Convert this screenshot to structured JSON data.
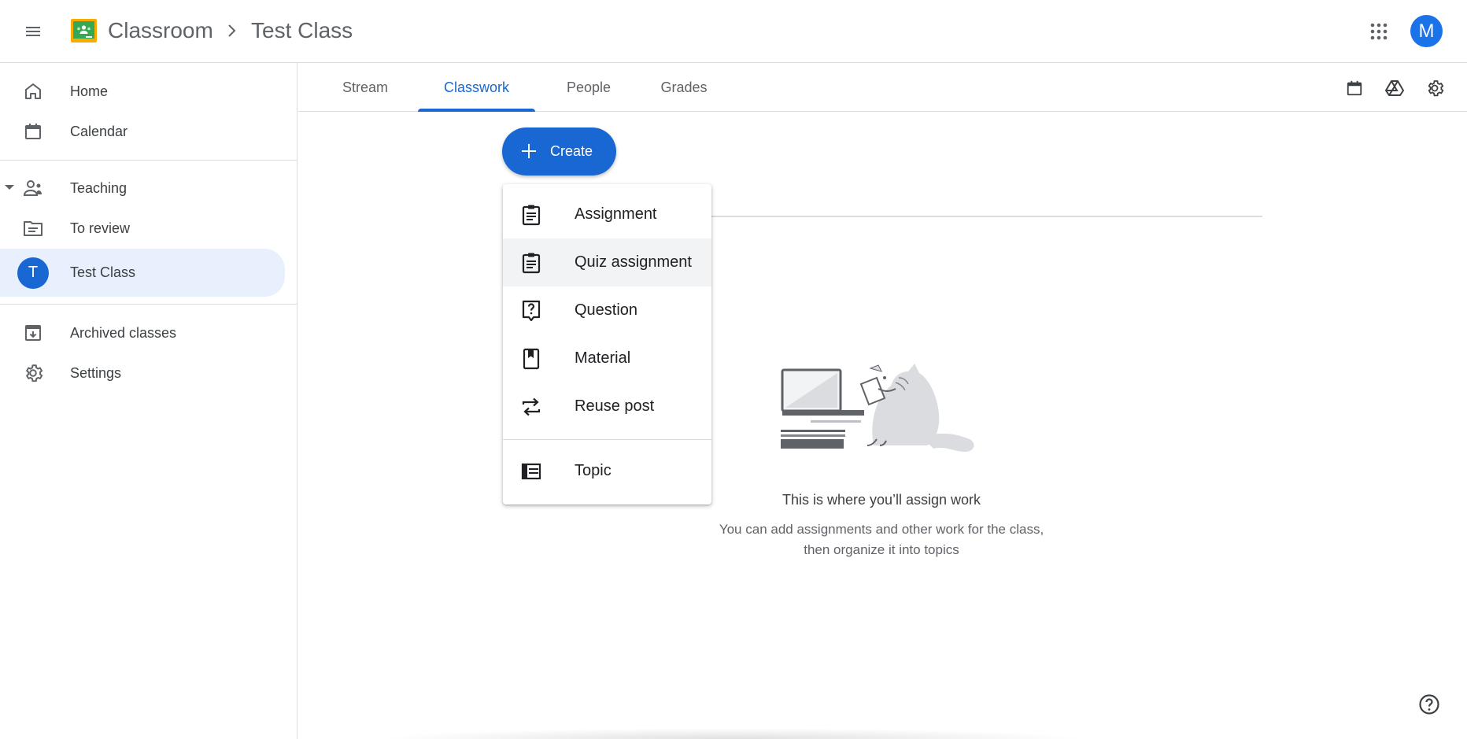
{
  "header": {
    "app_name": "Classroom",
    "breadcrumb_separator": "›",
    "class_name": "Test Class",
    "avatar_letter": "M",
    "avatar_color": "#1a73e8"
  },
  "sidebar": {
    "items": [
      {
        "label": "Home",
        "icon": "home-icon"
      },
      {
        "label": "Calendar",
        "icon": "calendar-icon"
      },
      {
        "label": "Teaching",
        "icon": "teaching-icon"
      },
      {
        "label": "To review",
        "icon": "to-review-icon"
      },
      {
        "label": "Test Class",
        "icon": "class-avatar",
        "avatar_letter": "T",
        "active": true
      },
      {
        "label": "Archived classes",
        "icon": "archive-icon"
      },
      {
        "label": "Settings",
        "icon": "gear-icon"
      }
    ]
  },
  "tabs": [
    {
      "label": "Stream"
    },
    {
      "label": "Classwork",
      "active": true
    },
    {
      "label": "People"
    },
    {
      "label": "Grades"
    }
  ],
  "toolbar": {
    "icons": [
      "calendar-icon",
      "drive-icon",
      "gear-icon"
    ]
  },
  "create_button": {
    "label": "Create",
    "icon": "plus-icon"
  },
  "create_menu": {
    "items": [
      {
        "label": "Assignment",
        "icon": "assignment-icon"
      },
      {
        "label": "Quiz assignment",
        "icon": "quiz-assignment-icon",
        "hovered": true
      },
      {
        "label": "Question",
        "icon": "question-icon"
      },
      {
        "label": "Material",
        "icon": "material-icon"
      },
      {
        "label": "Reuse post",
        "icon": "reuse-icon"
      },
      {
        "label": "Topic",
        "icon": "topic-icon"
      }
    ]
  },
  "empty_state": {
    "title": "This is where you’ll assign work",
    "subtitle": "You can add assignments and other work for the class, then organize it into topics"
  },
  "colors": {
    "primary": "#1967d2",
    "active_nav_bg": "#e8f0fe",
    "divider": "#dadce0"
  }
}
